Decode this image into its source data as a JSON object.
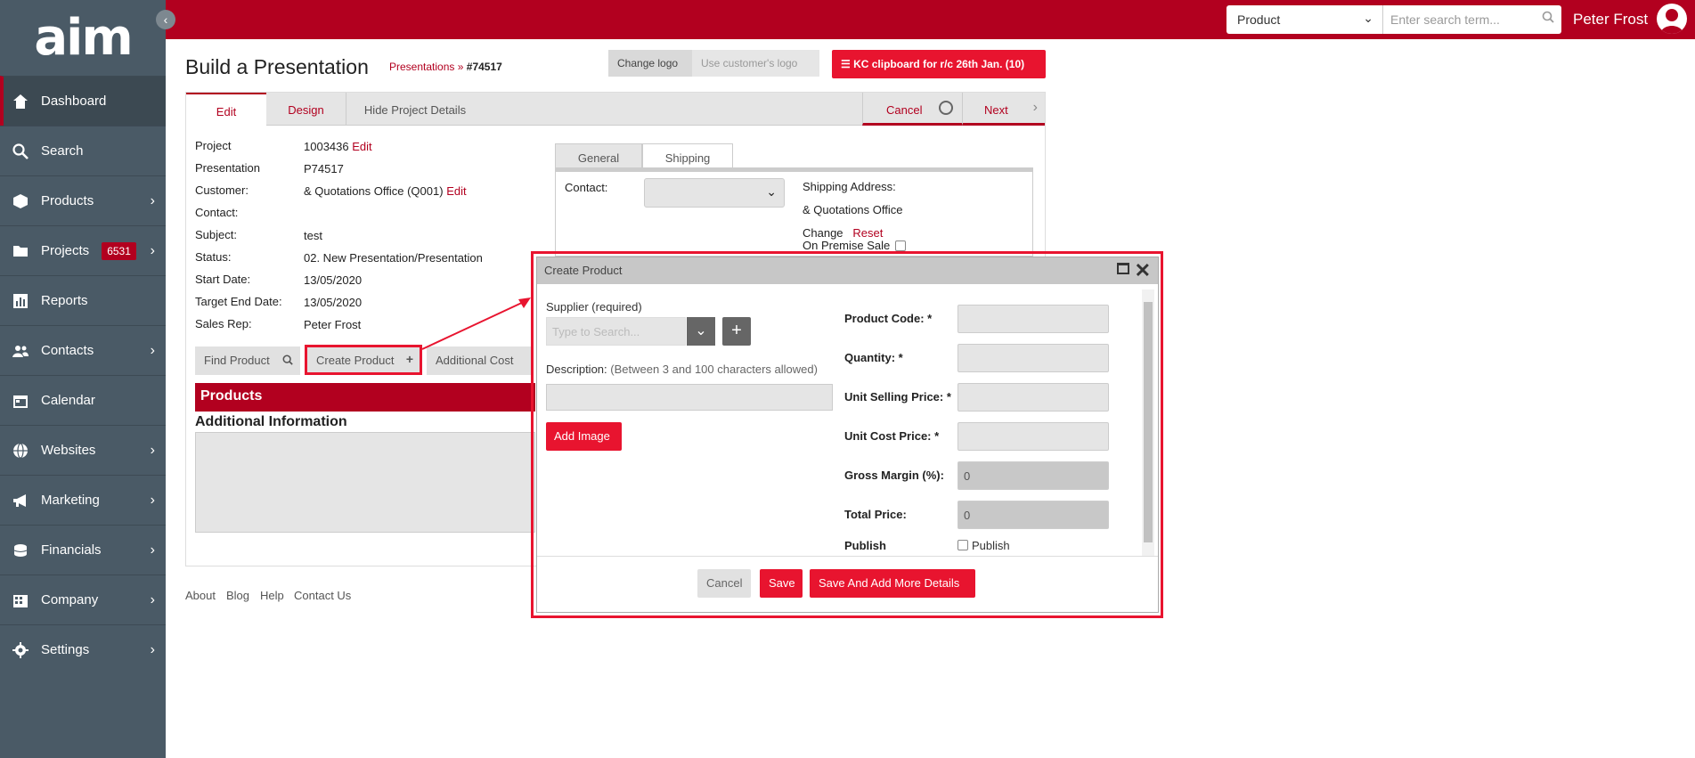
{
  "app": {
    "logo_text": "aim"
  },
  "sidebar": {
    "items": [
      {
        "label": "Dashboard",
        "icon": "home-icon",
        "active": true,
        "chevron": false
      },
      {
        "label": "Search",
        "icon": "search-icon",
        "chevron": false
      },
      {
        "label": "Products",
        "icon": "box-icon",
        "chevron": true
      },
      {
        "label": "Projects",
        "icon": "folder-icon",
        "chevron": true,
        "badge": "6531"
      },
      {
        "label": "Reports",
        "icon": "bar-chart-icon",
        "chevron": false
      },
      {
        "label": "Contacts",
        "icon": "users-icon",
        "chevron": true
      },
      {
        "label": "Calendar",
        "icon": "calendar-icon",
        "chevron": false
      },
      {
        "label": "Websites",
        "icon": "globe-icon",
        "chevron": true
      },
      {
        "label": "Marketing",
        "icon": "megaphone-icon",
        "chevron": true
      },
      {
        "label": "Financials",
        "icon": "coins-icon",
        "chevron": true
      },
      {
        "label": "Company",
        "icon": "building-icon",
        "chevron": true
      },
      {
        "label": "Settings",
        "icon": "gear-icon",
        "chevron": true
      }
    ]
  },
  "topbar": {
    "search_type": "Product",
    "search_placeholder": "Enter search term...",
    "user_name": "Peter Frost"
  },
  "page": {
    "title": "Build a Presentation",
    "breadcrumb_link": "Presentations",
    "breadcrumb_sep": "»",
    "breadcrumb_id": "#74517",
    "change_logo": "Change logo",
    "use_customer_logo": "Use customer's logo",
    "clipboard_button": "KC clipboard for r/c 26th Jan. (10)"
  },
  "tabs": {
    "edit": "Edit",
    "design": "Design",
    "hide": "Hide Project Details",
    "cancel": "Cancel",
    "next": "Next"
  },
  "details": {
    "project_label": "Project",
    "project_value": "1003436",
    "project_edit": "Edit",
    "presentation_label": "Presentation",
    "presentation_value": "P74517",
    "customer_label": "Customer:",
    "customer_value": "& Quotations Office (Q001)",
    "customer_edit": "Edit",
    "contact_label": "Contact:",
    "subject_label": "Subject:",
    "subject_value": "test",
    "status_label": "Status:",
    "status_value": "02. New Presentation/Presentation",
    "start_label": "Start Date:",
    "start_value": "13/05/2020",
    "target_label": "Target End Date:",
    "target_value": "13/05/2020",
    "salesrep_label": "Sales Rep:",
    "salesrep_value": "Peter Frost"
  },
  "actions": {
    "find_product": "Find Product",
    "create_product": "Create Product",
    "additional_cost": "Additional Cost"
  },
  "sections": {
    "products": "Products",
    "additional_info": "Additional Information"
  },
  "shipping": {
    "tab_general": "General",
    "tab_shipping": "Shipping",
    "contact_label": "Contact:",
    "address_label": "Shipping Address:",
    "address_value": "& Quotations Office",
    "change": "Change",
    "reset": "Reset",
    "on_premise": "On Premise Sale"
  },
  "footer": {
    "about": "About",
    "blog": "Blog",
    "help": "Help",
    "contact": "Contact Us"
  },
  "modal": {
    "title": "Create Product",
    "supplier_label": "Supplier (required)",
    "supplier_placeholder": "Type to Search...",
    "description_label": "Description:",
    "description_hint": "(Between 3 and 100 characters allowed)",
    "add_image": "Add Image",
    "product_code": "Product Code: *",
    "quantity": "Quantity: *",
    "unit_selling": "Unit Selling Price: *",
    "unit_cost": "Unit Cost Price: *",
    "gross_margin": "Gross Margin (%):",
    "gross_margin_value": "0",
    "total_price": "Total Price:",
    "total_price_value": "0",
    "publish_label": "Publish",
    "publish_checkbox": "Publish",
    "cancel": "Cancel",
    "save": "Save",
    "save_more": "Save And Add More Details"
  },
  "colors": {
    "brand": "#b2001f",
    "accent": "#e8142f",
    "sidebar": "#4a5a66"
  }
}
